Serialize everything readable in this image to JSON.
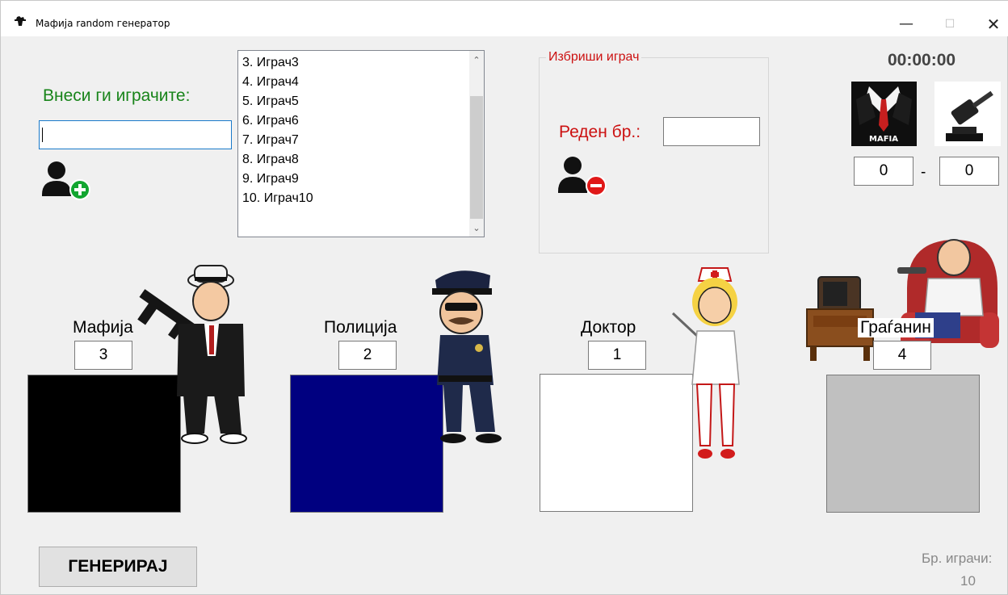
{
  "window": {
    "title": "Мафија random генератор",
    "minimize_glyph": "—",
    "maximize_glyph": "☐",
    "close_glyph": "✕"
  },
  "input_section": {
    "label": "Внеси ги играчите:",
    "value": ""
  },
  "players_list": {
    "items": [
      "3. Играч3",
      "4. Играч4",
      "5. Играч5",
      "6. Играч6",
      "7. Играч7",
      "8. Играч8",
      "9. Играч9",
      "10. Играч10"
    ]
  },
  "remove_group": {
    "title": "Избриши играч",
    "ord_label": "Реден бр.:",
    "ord_value": ""
  },
  "score": {
    "timer": "00:00:00",
    "mafia_text": "MAFIA",
    "mafia_score": "0",
    "separator": "-",
    "citizens_score": "0"
  },
  "roles": [
    {
      "label": "Мафија",
      "count": "3",
      "color": "#000000"
    },
    {
      "label": "Полиција",
      "count": "2",
      "color": "#000080"
    },
    {
      "label": "Доктор",
      "count": "1",
      "color": "#ffffff"
    },
    {
      "label": "Граѓанин",
      "count": "4",
      "color": "#c0c0c0"
    }
  ],
  "footer": {
    "generate_label": "ГЕНЕРИРАЈ",
    "player_count_label": "Бр. играчи:",
    "player_count": "10"
  }
}
